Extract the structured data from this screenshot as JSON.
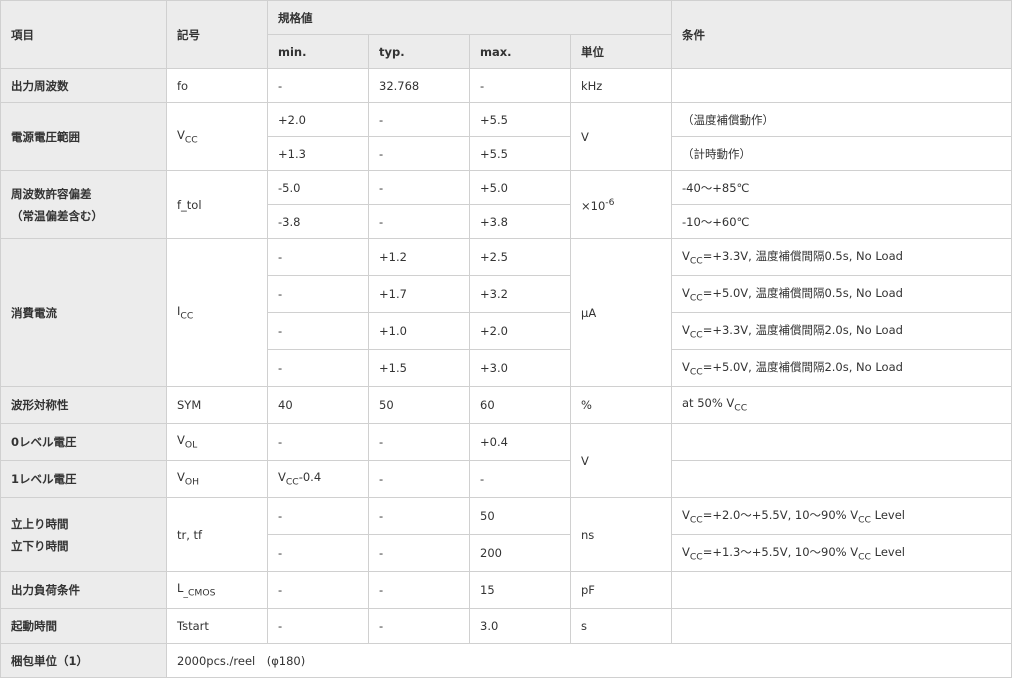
{
  "header": {
    "item": "項目",
    "symbol": "記号",
    "spec_group": "規格値",
    "min": "min.",
    "typ": "typ.",
    "max": "max.",
    "unit": "単位",
    "condition": "条件"
  },
  "rows": {
    "fo": {
      "item": "出力周波数",
      "symbol": "fo",
      "min": "-",
      "typ": "32.768",
      "max": "-",
      "unit": "kHz",
      "cond": ""
    },
    "vcc": {
      "item": "電源電圧範囲",
      "sym_main": "V",
      "sym_sub": "CC",
      "unit": "V",
      "r1": {
        "min": "+2.0",
        "typ": "-",
        "max": "+5.5",
        "cond": "（温度補償動作）"
      },
      "r2": {
        "min": "+1.3",
        "typ": "-",
        "max": "+5.5",
        "cond": "（計時動作）"
      }
    },
    "ftol": {
      "item_line1": "周波数許容偏差",
      "item_line2": "（常温偏差含む）",
      "symbol": "f_tol",
      "unit_base": "×10",
      "unit_exp": "-6",
      "r1": {
        "min": "-5.0",
        "typ": "-",
        "max": "+5.0",
        "cond": "-40～+85℃"
      },
      "r2": {
        "min": "-3.8",
        "typ": "-",
        "max": "+3.8",
        "cond": "-10～+60℃"
      }
    },
    "icc": {
      "item": "消費電流",
      "sym_main": "I",
      "sym_sub": "CC",
      "unit": "μA",
      "cond_prefix": "V",
      "cond_prefix_sub": "CC",
      "r1": {
        "min": "-",
        "typ": "+1.2",
        "max": "+2.5",
        "cond": "=+3.3V, 温度補償間隔0.5s, No Load"
      },
      "r2": {
        "min": "-",
        "typ": "+1.7",
        "max": "+3.2",
        "cond": "=+5.0V, 温度補償間隔0.5s, No Load"
      },
      "r3": {
        "min": "-",
        "typ": "+1.0",
        "max": "+2.0",
        "cond": "=+3.3V, 温度補償間隔2.0s, No Load"
      },
      "r4": {
        "min": "-",
        "typ": "+1.5",
        "max": "+3.0",
        "cond": "=+5.0V, 温度補償間隔2.0s, No Load"
      }
    },
    "sym": {
      "item": "波形対称性",
      "symbol": "SYM",
      "min": "40",
      "typ": "50",
      "max": "60",
      "unit": "%",
      "cond_text": "at 50% V",
      "cond_sub": "CC"
    },
    "vol": {
      "item": "0レベル電圧",
      "sym_main": "V",
      "sym_sub": "OL",
      "min": "-",
      "typ": "-",
      "max": "+0.4",
      "unit": "V"
    },
    "voh": {
      "item": "1レベル電圧",
      "sym_main": "V",
      "sym_sub": "OH",
      "min_main": "V",
      "min_sub": "CC",
      "min_tail": "-0.4",
      "typ": "-",
      "max": "-"
    },
    "trtf": {
      "item_line1": "立上り時間",
      "item_line2": "立下り時間",
      "symbol": "tr, tf",
      "unit": "ns",
      "r1": {
        "min": "-",
        "typ": "-",
        "max": "50",
        "c1": "V",
        "c1_sub": "CC",
        "c2": "=+2.0～+5.5V, 10～90% V",
        "c2_sub": "CC",
        "c3": " Level"
      },
      "r2": {
        "min": "-",
        "typ": "-",
        "max": "200",
        "c1": "V",
        "c1_sub": "CC",
        "c2": "=+1.3～+5.5V, 10～90% V",
        "c2_sub": "CC",
        "c3": " Level"
      }
    },
    "load": {
      "item": "出力負荷条件",
      "sym_main": "L",
      "sym_sub": "_CMOS",
      "min": "-",
      "typ": "-",
      "max": "15",
      "unit": "pF",
      "cond": ""
    },
    "tstart": {
      "item": "起動時間",
      "symbol": "Tstart",
      "min": "-",
      "typ": "-",
      "max": "3.0",
      "unit": "s",
      "cond": ""
    },
    "pack": {
      "item": "梱包単位（1）",
      "value": "2000pcs./reel　(φ180)"
    }
  }
}
